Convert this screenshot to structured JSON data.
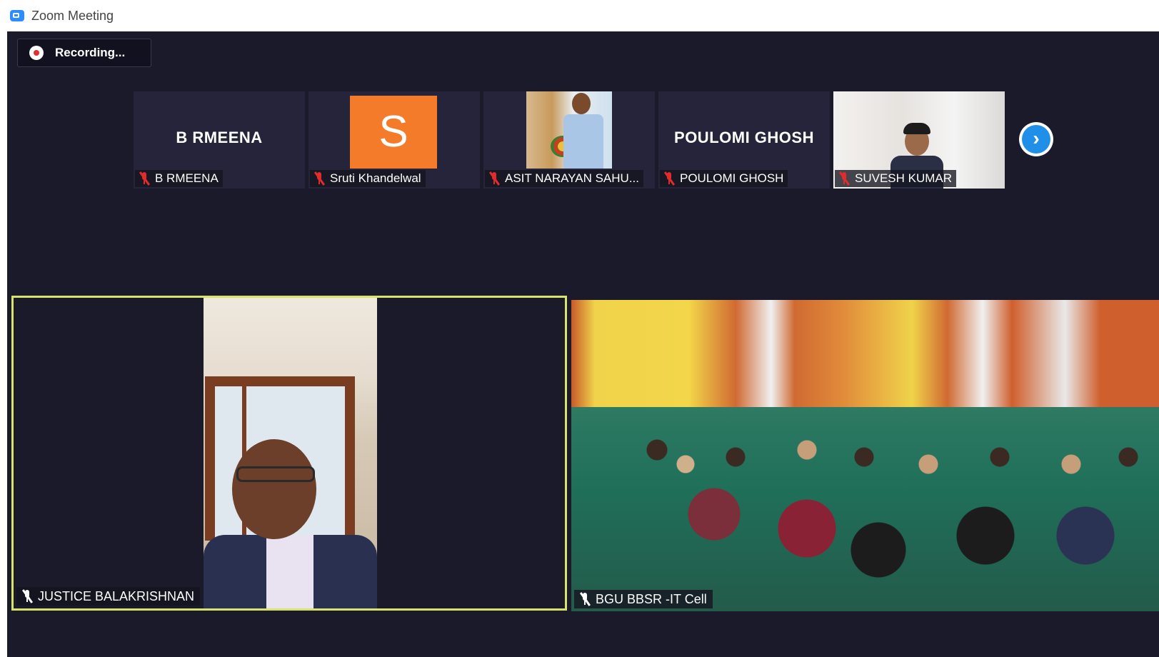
{
  "window": {
    "title": "Zoom Meeting"
  },
  "recording": {
    "label": "Recording..."
  },
  "gallery_strip": [
    {
      "big_name": "B RMEENA",
      "name_tag": "B RMEENA",
      "muted": true,
      "video": "none"
    },
    {
      "avatar_letter": "S",
      "name_tag": "Sruti Khandelwal",
      "muted": true,
      "video": "avatar"
    },
    {
      "name_tag": "ASIT NARAYAN SAHU...",
      "muted": true,
      "video": "camera"
    },
    {
      "big_name": "POULOMI GHOSH",
      "name_tag": "POULOMI GHOSH",
      "muted": true,
      "video": "none"
    },
    {
      "name_tag": "SUVESH KUMAR",
      "muted": true,
      "video": "camera"
    }
  ],
  "next_page": {
    "glyph": "›"
  },
  "main_videos": {
    "speaker": {
      "name_tag": "JUSTICE BALAKRISHNAN"
    },
    "room": {
      "name_tag": "BGU BBSR -IT Cell"
    }
  },
  "colors": {
    "active_speaker_border": "#d7e36a",
    "muted_icon": "#e22c2c",
    "accent": "#1f8fe8",
    "background": "#1b1a2b"
  }
}
